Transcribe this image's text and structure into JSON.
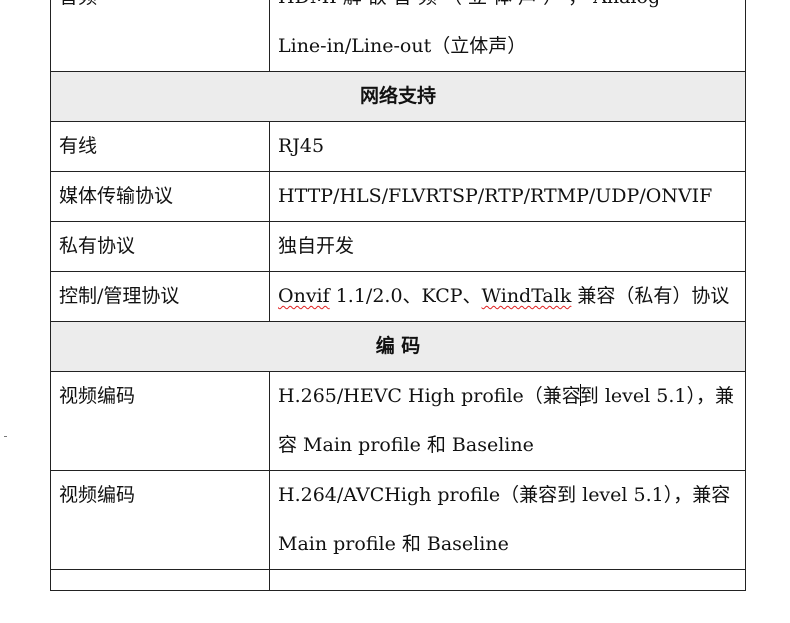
{
  "rows": [
    {
      "label": "音频",
      "value_lines": [
        "HDMI 解 嵌 音 频 （ 立 体 声 ） ， Analog",
        "Line-in/Line-out（立体声）"
      ]
    },
    {
      "section": "网络支持"
    },
    {
      "label": "有线",
      "value": "RJ45"
    },
    {
      "label": "媒体传输协议",
      "value": "HTTP/HLS/FLVRTSP/RTP/RTMP/UDP/ONVIF"
    },
    {
      "label": "私有协议",
      "value": "独自开发"
    },
    {
      "label": "控制/管理协议",
      "value_parts": [
        "Onvif",
        " 1.1/2.0、KCP、",
        "WindTalk",
        " 兼容（私有）协议"
      ]
    },
    {
      "section": "编 码"
    },
    {
      "label": "视频编码",
      "value_parts": [
        "H.265/HEVC High profile（兼容",
        "到 level 5.1），兼容 Main profile 和 Baseline"
      ]
    },
    {
      "label": "视频编码",
      "value": "H.264/AVCHigh profile（兼容到 level 5.1），兼容 Main profile 和 Baseline"
    }
  ]
}
